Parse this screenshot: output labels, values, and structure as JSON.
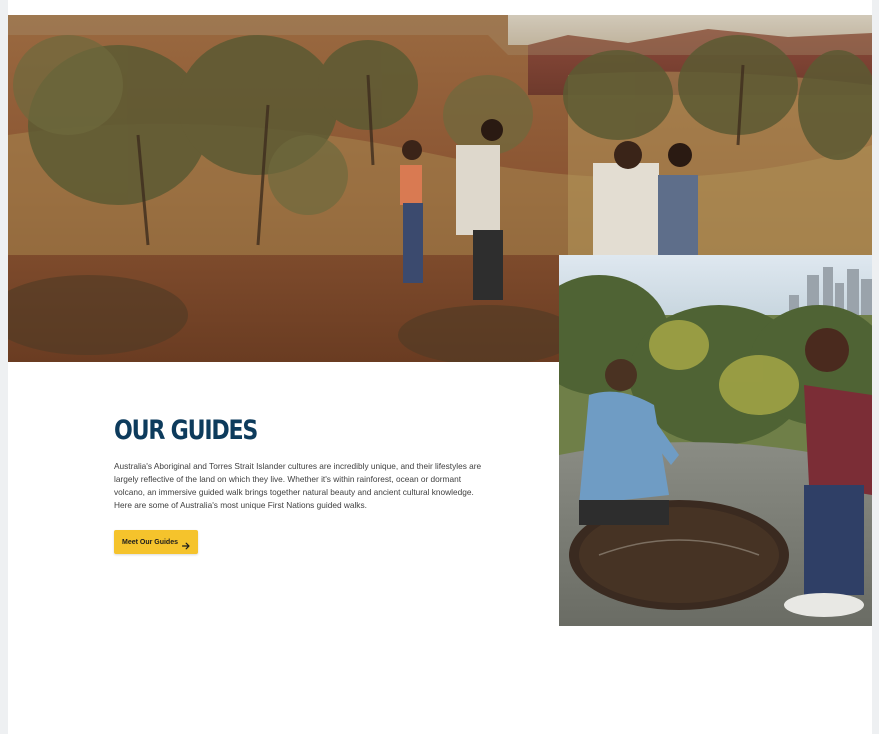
{
  "section": {
    "heading": "OUR GUIDES",
    "body": "Australia's Aboriginal and Torres Strait Islander cultures are incredibly unique, and their lifestyles are largely reflective of the land on which they live. Whether it's within rainforest, ocean or dormant volcano, an immersive guided walk brings together natural beauty and ancient cultural knowledge. Here are some of Australia's most unique First Nations guided walks.",
    "cta_label": "Meet Our Guides",
    "cta_icon": "arrow-right-icon"
  },
  "colors": {
    "heading": "#0d3b5c",
    "cta_background": "#f5c32c",
    "body_text": "#404040"
  }
}
